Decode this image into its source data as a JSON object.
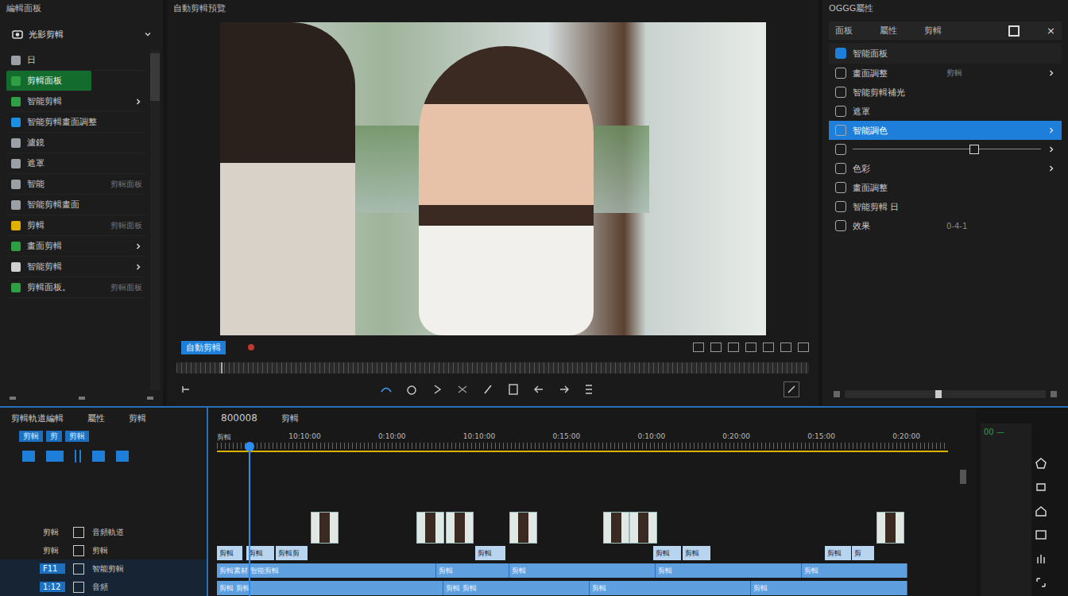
{
  "window": {
    "title": "自動剪輯預覽"
  },
  "left_panel": {
    "title": "編輯面板",
    "dropdown": "光影剪輯",
    "items": [
      {
        "label": "日",
        "hint": "",
        "selected": false,
        "arrow": false,
        "color": "#9aa0a6"
      },
      {
        "label": "剪輯面板",
        "hint": "",
        "selected": true,
        "arrow": false,
        "color": "#2ea043"
      },
      {
        "label": "智能剪輯",
        "hint": "",
        "selected": false,
        "arrow": true,
        "color": "#2ea043"
      },
      {
        "label": "智能剪輯畫面調整",
        "hint": "",
        "selected": false,
        "arrow": false,
        "color": "#1d8fe0"
      },
      {
        "label": "濾鏡",
        "hint": "",
        "selected": false,
        "arrow": false,
        "color": "#9aa0a6"
      },
      {
        "label": "遮罩",
        "hint": "",
        "selected": false,
        "arrow": false,
        "color": "#9aa0a6"
      },
      {
        "label": "智能",
        "hint": "剪輯面板",
        "selected": false,
        "arrow": false,
        "color": "#9aa0a6"
      },
      {
        "label": "智能剪輯畫面",
        "hint": "",
        "selected": false,
        "arrow": false,
        "color": "#9aa0a6"
      },
      {
        "label": "剪輯",
        "hint": "剪輯面板",
        "selected": false,
        "arrow": false,
        "color": "#e0b000"
      },
      {
        "label": "畫面剪輯",
        "hint": "",
        "selected": false,
        "arrow": true,
        "color": "#2ea043"
      },
      {
        "label": "智能剪輯",
        "hint": "",
        "selected": false,
        "arrow": true,
        "color": "#d0d0d0"
      },
      {
        "label": "剪輯面板。",
        "hint": "剪輯面板",
        "selected": false,
        "arrow": false,
        "color": "#2ea043"
      }
    ]
  },
  "preview": {
    "tag": "自動剪輯",
    "scrub_level": 0.07
  },
  "right_panel": {
    "title": "OGGG屬性",
    "tabs": [
      {
        "label": "面板",
        "selected": false
      },
      {
        "label": "屬性",
        "selected": false
      },
      {
        "label": "剪輯",
        "selected": false
      }
    ],
    "close": "×",
    "items": [
      {
        "kind": "header",
        "label": "智能面板",
        "value": "",
        "arrow": false,
        "selected": false,
        "level": 0
      },
      {
        "kind": "row",
        "label": "畫面調整",
        "value": "剪輯",
        "arrow": true,
        "selected": false,
        "level": 0
      },
      {
        "kind": "row",
        "label": "智能剪輯補光",
        "value": "",
        "arrow": false,
        "selected": false,
        "level": 0
      },
      {
        "kind": "row",
        "label": "遮罩",
        "value": "",
        "arrow": false,
        "selected": false,
        "level": 0
      },
      {
        "kind": "row",
        "label": "智能調色",
        "value": "",
        "arrow": true,
        "selected": true,
        "level": 0
      },
      {
        "kind": "slider",
        "label": "",
        "value": "",
        "arrow": true,
        "selected": false,
        "level": 0.62
      },
      {
        "kind": "row",
        "label": "色彩",
        "value": "",
        "arrow": true,
        "selected": false,
        "level": 0
      },
      {
        "kind": "row",
        "label": "畫面調整",
        "value": "",
        "arrow": false,
        "selected": false,
        "level": 0
      },
      {
        "kind": "row",
        "label": "智能剪輯 日",
        "value": "",
        "arrow": false,
        "selected": false,
        "level": 0
      },
      {
        "kind": "row",
        "label": "效果",
        "value": "0-4-1",
        "arrow": false,
        "selected": false,
        "level": 0
      }
    ],
    "zoom_level": 0.45
  },
  "timeline": {
    "title": "剪輯軌道編輯",
    "tabs": [
      "屬性",
      "剪輯"
    ],
    "chips": [
      {
        "label": "剪輯",
        "selected": true
      },
      {
        "label": "剪",
        "selected": true
      },
      {
        "label": "剪輯",
        "selected": true
      }
    ],
    "timecode": "800008",
    "timecode_label": "剪輯",
    "ruler": [
      "剪輯",
      "10:10:00",
      "0:10:00",
      "10:10:00",
      "0:15:00",
      "0:10:00",
      "0:20:00",
      "0:15:00",
      "0:20:00"
    ],
    "playhead": 0.043,
    "tracks": [
      {
        "name": "剪輯",
        "label": "音頻軌道",
        "selected": false,
        "clips": [
          {
            "kind": "thumb",
            "start": 0.128,
            "length": 0.038,
            "label": ""
          },
          {
            "kind": "thumb",
            "start": 0.273,
            "length": 0.038,
            "label": ""
          },
          {
            "kind": "thumb",
            "start": 0.313,
            "length": 0.038,
            "label": ""
          },
          {
            "kind": "thumb",
            "start": 0.4,
            "length": 0.038,
            "label": ""
          },
          {
            "kind": "thumb",
            "start": 0.528,
            "length": 0.036,
            "label": ""
          },
          {
            "kind": "thumb",
            "start": 0.564,
            "length": 0.038,
            "label": ""
          },
          {
            "kind": "thumb",
            "start": 0.902,
            "length": 0.038,
            "label": ""
          }
        ]
      },
      {
        "name": "剪輯",
        "label": "剪輯",
        "selected": false,
        "clips": [
          {
            "kind": "label",
            "start": 0,
            "length": 0.035,
            "label": "剪輯"
          },
          {
            "kind": "label",
            "start": 0.04,
            "length": 0.038,
            "label": "剪輯"
          },
          {
            "kind": "label",
            "start": 0.08,
            "length": 0.044,
            "label": "剪輯剪"
          },
          {
            "kind": "label",
            "start": 0.353,
            "length": 0.042,
            "label": "剪輯"
          },
          {
            "kind": "label",
            "start": 0.597,
            "length": 0.038,
            "label": "剪輯"
          },
          {
            "kind": "label",
            "start": 0.637,
            "length": 0.038,
            "label": "剪輯"
          },
          {
            "kind": "label",
            "start": 0.831,
            "length": 0.036,
            "label": "剪輯"
          },
          {
            "kind": "label",
            "start": 0.869,
            "length": 0.03,
            "label": "剪"
          }
        ]
      },
      {
        "name": "F11",
        "label": "智能剪輯",
        "selected": true,
        "clips": [
          {
            "kind": "bar",
            "start": 0,
            "length": 0.3,
            "label": "剪輯素材 智能剪輯"
          },
          {
            "kind": "bar",
            "start": 0.3,
            "length": 0.1,
            "label": "剪輯"
          },
          {
            "kind": "bar",
            "start": 0.4,
            "length": 0.2,
            "label": "剪輯"
          },
          {
            "kind": "bar",
            "start": 0.6,
            "length": 0.2,
            "label": "剪輯"
          },
          {
            "kind": "bar",
            "start": 0.8,
            "length": 0.145,
            "label": "剪輯"
          }
        ]
      },
      {
        "name": "1:12",
        "label": "音頻",
        "selected": true,
        "clips": [
          {
            "kind": "bar",
            "start": 0,
            "length": 0.31,
            "label": "剪輯 剪輯"
          },
          {
            "kind": "bar",
            "start": 0.31,
            "length": 0.2,
            "label": "剪輯 剪輯"
          },
          {
            "kind": "bar",
            "start": 0.51,
            "length": 0.22,
            "label": "剪輯"
          },
          {
            "kind": "bar",
            "start": 0.73,
            "length": 0.215,
            "label": "剪輯"
          }
        ]
      }
    ]
  },
  "tools": {
    "label": "00 —"
  }
}
